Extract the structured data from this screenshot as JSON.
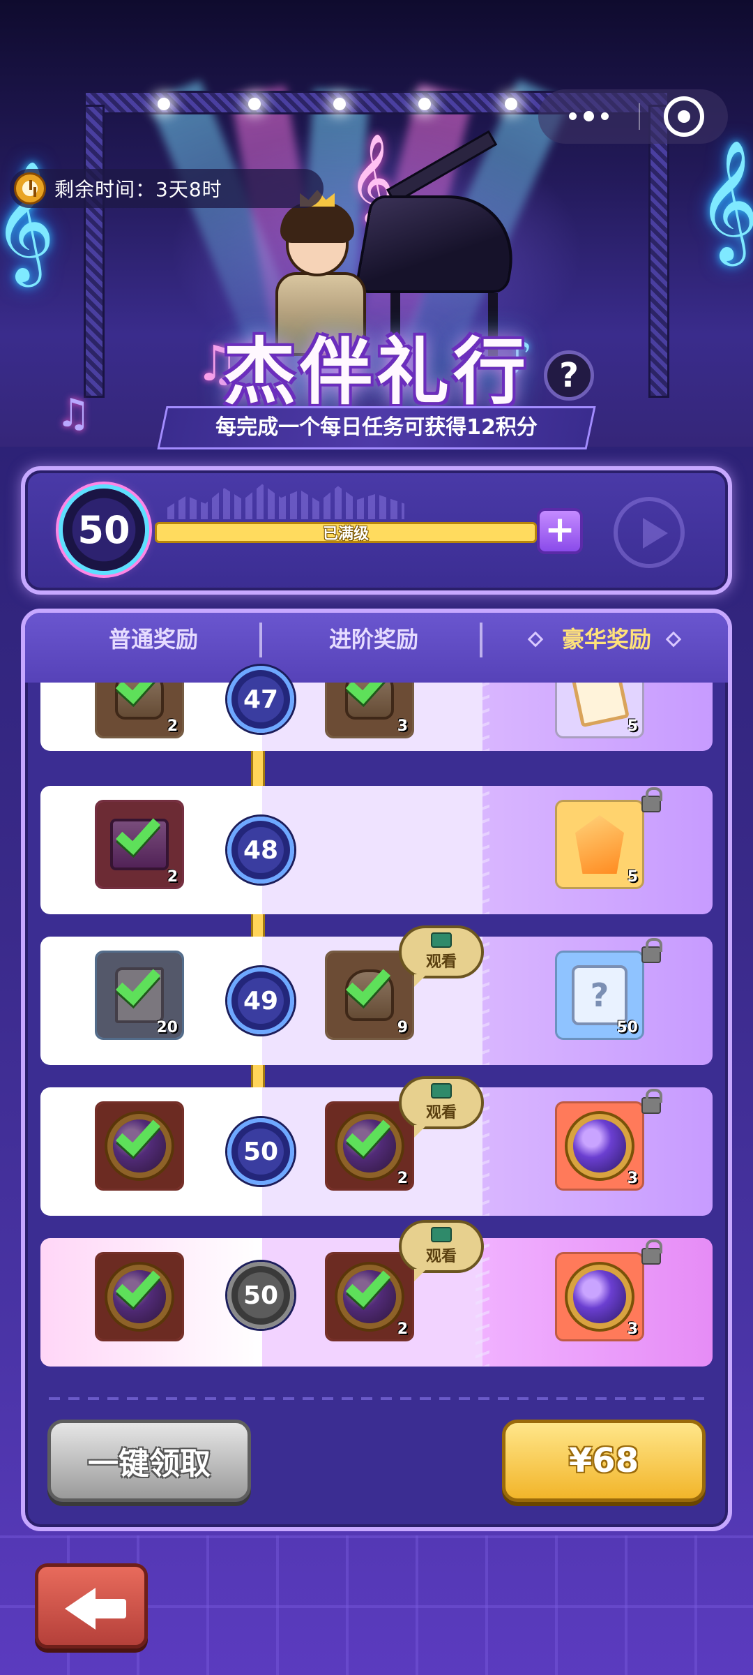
{
  "header": {
    "remaining_time_label": "剩余时间：3天8时",
    "title": "杰伴礼行",
    "help_label": "?",
    "subtitle": "每完成一个每日任务可获得12积分"
  },
  "progress": {
    "level": "50",
    "bar_text": "已满级",
    "fill_fraction": 1.0,
    "plus_label": "+"
  },
  "tabs": {
    "normal": "普通奖励",
    "advanced": "进阶奖励",
    "luxury": "豪华奖励"
  },
  "rows": [
    {
      "level": "47",
      "normal": {
        "icon": "bag-icon",
        "count": "2",
        "claimed": true
      },
      "advanced": {
        "icon": "bag-icon",
        "count": "3",
        "claimed": true
      },
      "luxury": {
        "icon": "card-icon",
        "count": "5",
        "locked": false
      }
    },
    {
      "level": "48",
      "normal": {
        "icon": "chest-icon",
        "count": "2",
        "claimed": true
      },
      "luxury": {
        "icon": "crystal-icon",
        "count": "5",
        "locked": true
      }
    },
    {
      "level": "49",
      "normal": {
        "icon": "scroll-icon",
        "count": "20",
        "claimed": true
      },
      "advanced": {
        "icon": "bag-icon",
        "count": "9",
        "claimed": true,
        "watch": true
      },
      "luxury": {
        "icon": "mystery-scroll-icon",
        "count": "50",
        "locked": true
      }
    },
    {
      "level": "50",
      "normal": {
        "icon": "orb-icon",
        "claimed": true
      },
      "advanced": {
        "icon": "orb-icon",
        "count": "2",
        "claimed": true,
        "watch": true
      },
      "luxury": {
        "icon": "orb-icon",
        "count": "3",
        "locked": true
      }
    },
    {
      "level": "50",
      "normal": {
        "icon": "orb-icon",
        "claimed": true
      },
      "advanced": {
        "icon": "orb-icon",
        "count": "2",
        "claimed": true,
        "watch": true
      },
      "luxury": {
        "icon": "orb-icon",
        "count": "3",
        "locked": true
      }
    }
  ],
  "watch_label": "观看",
  "footer": {
    "claim_all": "一键领取",
    "price": "¥68"
  },
  "colors": {
    "accent_gold": "#ffdb5e",
    "panel_border": "#c7a8ff",
    "check_green": "#5ee05a"
  }
}
